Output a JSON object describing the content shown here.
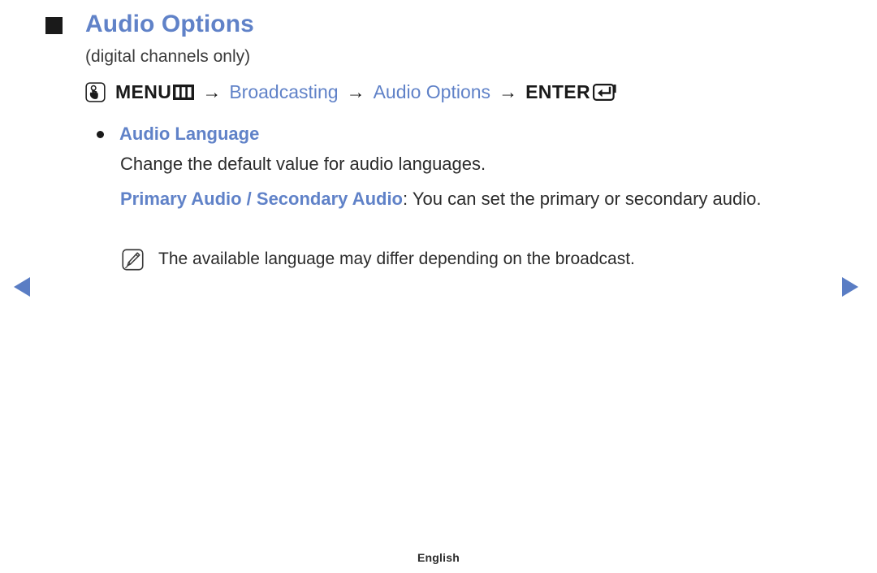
{
  "page": {
    "background_color": "#ffffff",
    "accent_color": "#6082c8",
    "text_color": "#2b2b2b"
  },
  "heading": {
    "bullet_icon": "filled-square-icon",
    "title": "Audio Options",
    "subtitle": "(digital channels only)"
  },
  "menu_path": {
    "touch_icon": "hand-press-button-icon",
    "menu_label": "MENU",
    "menu_icon": "menu-bars-icon",
    "arrow": "→",
    "step_broadcasting": "Broadcasting",
    "step_audio_options": "Audio Options",
    "enter_label": "ENTER",
    "enter_icon": "enter-return-icon"
  },
  "content": {
    "bullet_icon": "round-bullet-icon",
    "bullet_label": "Audio Language",
    "description_line": "Change the default value for audio languages.",
    "detail_strong": "Primary Audio / Secondary Audio",
    "detail_rest": ": You can set the primary or secondary audio.",
    "note": {
      "icon": "note-pencil-icon",
      "text": "The available language may differ depending on the broadcast."
    }
  },
  "navigation": {
    "prev_icon": "triangle-left-icon",
    "prev_label": "Previous page",
    "next_icon": "triangle-right-icon",
    "next_label": "Next page"
  },
  "footer": {
    "language": "English"
  }
}
